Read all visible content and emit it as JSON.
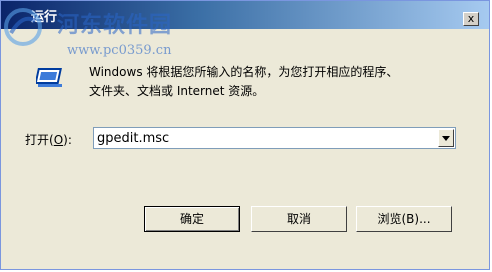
{
  "window": {
    "title": "运行",
    "close_glyph": "x"
  },
  "watermark": {
    "site_name": "河东软件园",
    "url": "www.pc0359.cn"
  },
  "dialog": {
    "description_line1": "Windows 将根据您所输入的名称，为您打开相应的程序、",
    "description_line2": "文件夹、文档或 Internet 资源。",
    "open_label_prefix": "打开(",
    "open_label_key": "O",
    "open_label_suffix": "):",
    "input_value": "gpedit.msc"
  },
  "buttons": {
    "ok": "确定",
    "cancel": "取消",
    "browse": "浏览(B)..."
  },
  "colors": {
    "titlebar_start": "#0a246a",
    "dialog_bg": "#ece9d8"
  }
}
